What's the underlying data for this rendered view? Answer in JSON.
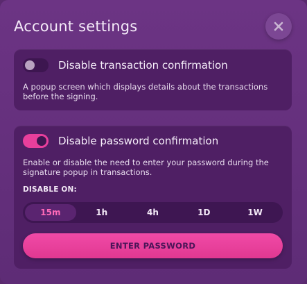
{
  "modal": {
    "title": "Account settings"
  },
  "options": [
    {
      "label": "Disable transaction confirmation",
      "enabled": false,
      "description": "A popup screen which displays details about the transactions before the signing."
    },
    {
      "label": "Disable password confirmation",
      "enabled": true,
      "description": "Enable or disable the need to enter your password during the signature popup in transactions."
    }
  ],
  "disable_on": {
    "label": "DISABLE ON:",
    "options": [
      "15m",
      "1h",
      "4h",
      "1D",
      "1W"
    ],
    "selected": "15m"
  },
  "enter_password_label": "ENTER PASSWORD",
  "colors": {
    "accent": "#e83f9c",
    "background": "#6c3484",
    "card": "#4f1f64"
  },
  "icons": {
    "close": "close-icon"
  }
}
